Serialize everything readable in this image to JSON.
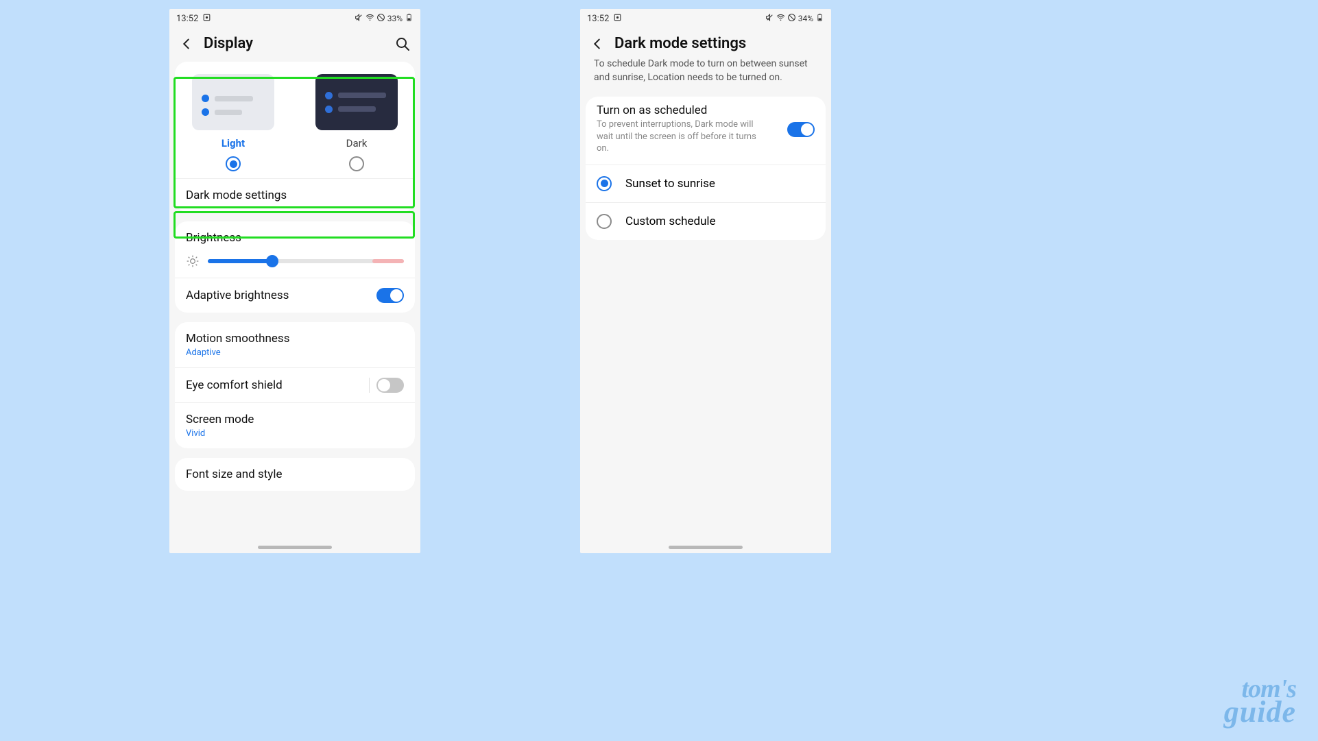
{
  "left": {
    "status": {
      "time": "13:52",
      "battery": "33%"
    },
    "header": {
      "title": "Display"
    },
    "theme": {
      "light_label": "Light",
      "dark_label": "Dark",
      "selected": "light"
    },
    "dark_mode_settings_label": "Dark mode settings",
    "brightness": {
      "label": "Brightness",
      "value_pct": 33
    },
    "adaptive_brightness": {
      "label": "Adaptive brightness",
      "on": true
    },
    "motion_smoothness": {
      "label": "Motion smoothness",
      "value": "Adaptive"
    },
    "eye_comfort": {
      "label": "Eye comfort shield",
      "on": false
    },
    "screen_mode": {
      "label": "Screen mode",
      "value": "Vivid"
    },
    "font": {
      "label": "Font size and style"
    }
  },
  "right": {
    "status": {
      "time": "13:52",
      "battery": "34%"
    },
    "header": {
      "title": "Dark mode settings"
    },
    "info": "To schedule Dark mode to turn on between sunset and sunrise, Location needs to be turned on.",
    "scheduled": {
      "title": "Turn on as scheduled",
      "desc": "To prevent interruptions, Dark mode will wait until the screen is off before it turns on.",
      "on": true
    },
    "options": {
      "sunset": "Sunset to sunrise",
      "custom": "Custom schedule",
      "selected": "sunset"
    }
  },
  "watermark": {
    "line1": "tom's",
    "line2": "guide"
  }
}
